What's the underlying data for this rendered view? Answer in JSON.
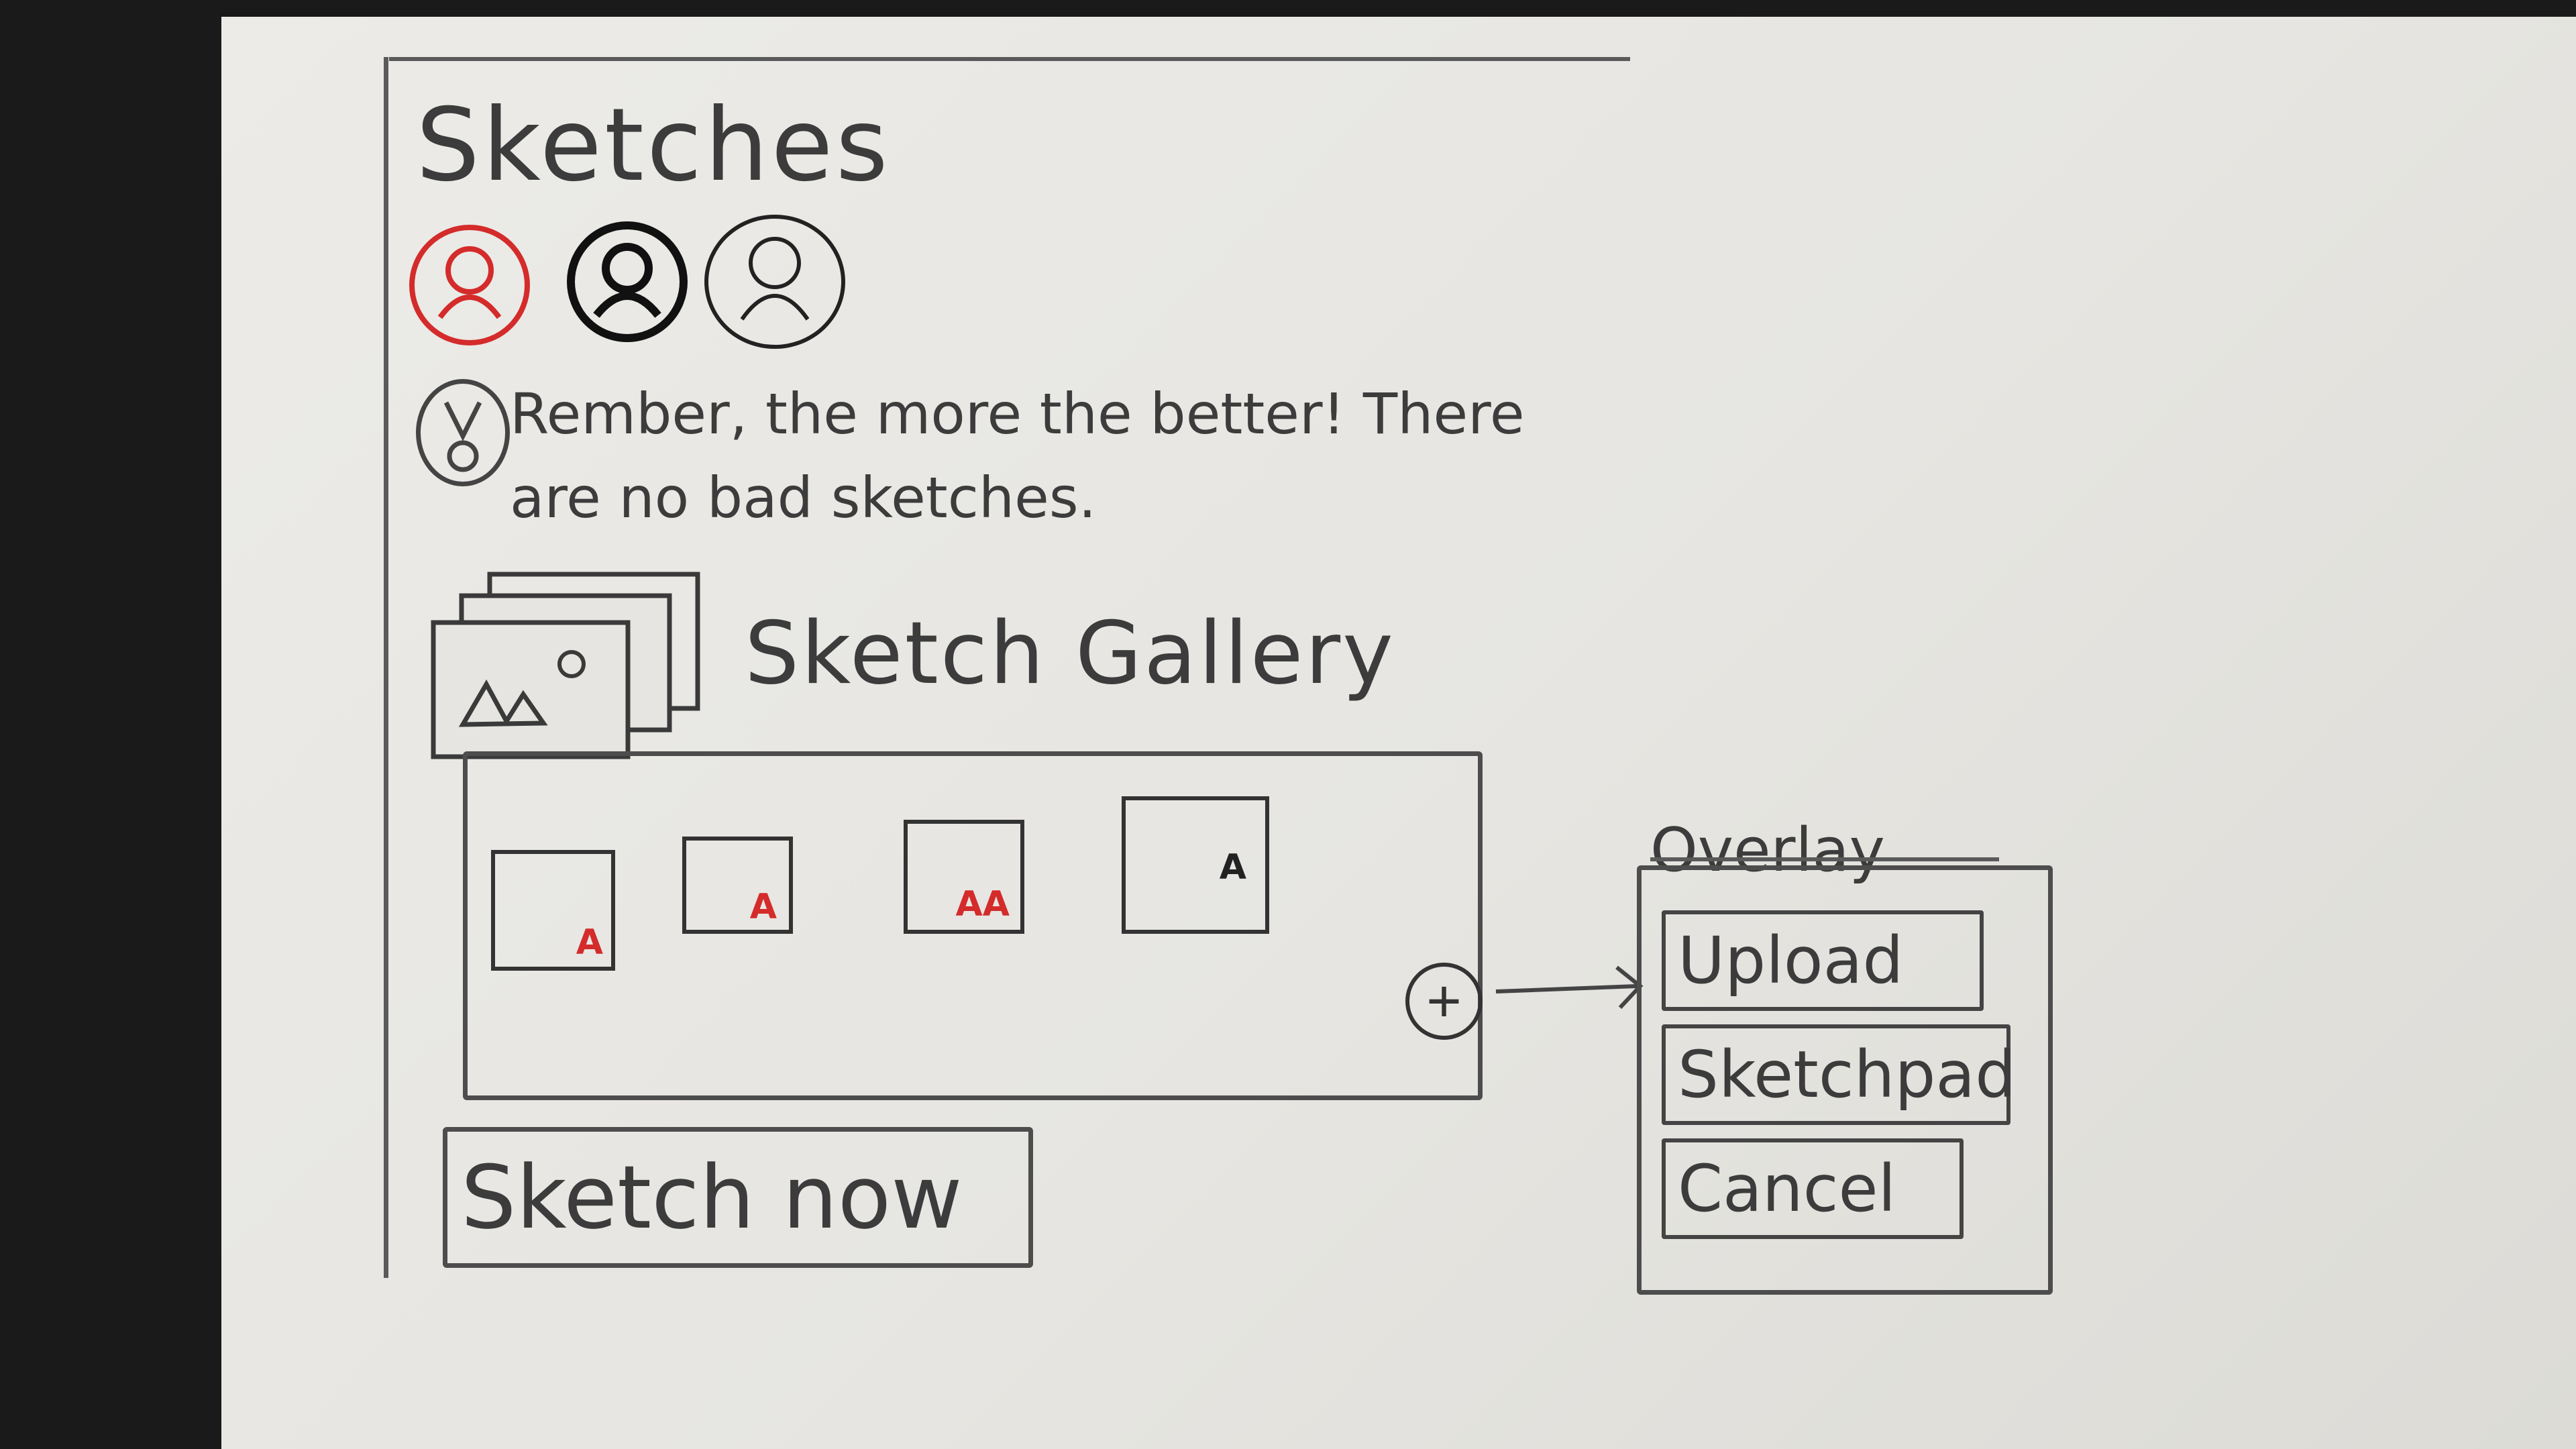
{
  "page": {
    "title": "Sketches",
    "tip": {
      "line1": "Rember, the more the better! There",
      "line2": "are no bad sketches."
    },
    "gallery": {
      "title": "Sketch Gallery",
      "thumbnails": [
        {
          "badge": "A",
          "badge_color": "#d42b2b"
        },
        {
          "badge": "A",
          "badge_color": "#d42b2b"
        },
        {
          "badge": "AA",
          "badge_color": "#d42b2b"
        },
        {
          "badge": "A",
          "badge_color": "#222222"
        }
      ],
      "add_label": "+"
    },
    "sketch_now_label": "Sketch now"
  },
  "overlay": {
    "label": "Overlay",
    "buttons": {
      "upload": "Upload",
      "sketchpad": "Sketchpad",
      "cancel": "Cancel"
    }
  },
  "colors": {
    "accent_red": "#d42b2b",
    "ink": "#3c3c3c"
  },
  "icons": [
    "avatar-icon",
    "lightbulb-icon",
    "image-gallery-icon",
    "plus-icon",
    "arrow-right-icon"
  ]
}
